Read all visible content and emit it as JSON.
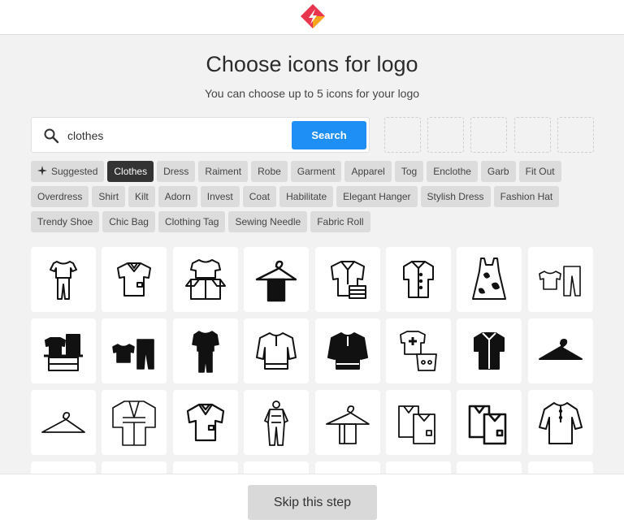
{
  "header": {
    "title": "Choose icons for logo",
    "subtitle": "You can choose up to 5 icons for your logo"
  },
  "search": {
    "value": "clothes",
    "placeholder": "",
    "button_label": "Search"
  },
  "tags": [
    {
      "label": "Suggested"
    },
    {
      "label": "Clothes"
    },
    {
      "label": "Dress"
    },
    {
      "label": "Raiment"
    },
    {
      "label": "Robe"
    },
    {
      "label": "Garment"
    },
    {
      "label": "Apparel"
    },
    {
      "label": "Tog"
    },
    {
      "label": "Enclothe"
    },
    {
      "label": "Garb"
    },
    {
      "label": "Fit Out"
    },
    {
      "label": "Overdress"
    },
    {
      "label": "Shirt"
    },
    {
      "label": "Kilt"
    },
    {
      "label": "Adorn"
    },
    {
      "label": "Invest"
    },
    {
      "label": "Coat"
    },
    {
      "label": "Habilitate"
    },
    {
      "label": "Elegant Hanger"
    },
    {
      "label": "Stylish Dress"
    },
    {
      "label": "Fashion Hat"
    },
    {
      "label": "Trendy Shoe"
    },
    {
      "label": "Chic Bag"
    },
    {
      "label": "Clothing Tag"
    },
    {
      "label": "Sewing Needle"
    },
    {
      "label": "Fabric Roll"
    }
  ],
  "footer": {
    "skip_label": "Skip this step"
  },
  "colors": {
    "accent": "#1e8ff5",
    "active_tag": "#333333",
    "logo_red": "#e8364f",
    "logo_orange": "#f7a51c"
  },
  "icons": [
    "tshirt-pants-icon",
    "polo-shirt-icon",
    "clothes-box-icon",
    "towel-hanger-icon",
    "shirt-folded-icon",
    "button-shirt-icon",
    "stained-dress-icon",
    "shirt-pants-icon",
    "clothes-rack-icon",
    "shirt-pants-filled-icon",
    "outfit-filled-icon",
    "sweater-icon",
    "sweater-filled-icon",
    "laundry-basket-icon",
    "button-shirt-filled-icon",
    "hanger-filled-icon",
    "hanger-icon",
    "kimono-icon",
    "polo-shirt-outline-icon",
    "overalls-icon",
    "towel-on-hanger-icon",
    "stacked-shirts-icon",
    "stacked-shirts-bold-icon",
    "long-shirt-icon"
  ]
}
